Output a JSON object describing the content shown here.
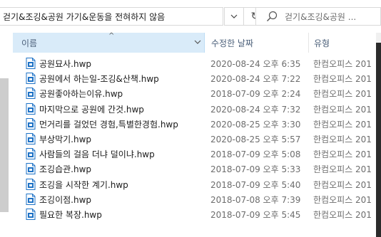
{
  "address": {
    "path": "걷기&조깅&공원 가기&운동을 전혀하지 않음"
  },
  "search": {
    "placeholder": "걷기&조깅&공원 ..."
  },
  "columns": {
    "name": "이름",
    "date": "수정한 날짜",
    "type": "유형"
  },
  "files": [
    {
      "name": "공원묘사.hwp",
      "date": "2020-08-24 오후 6:35",
      "type": "한컴오피스 201"
    },
    {
      "name": "공원에서 하는일-조깅&산책.hwp",
      "date": "2020-08-24 오후 7:22",
      "type": "한컴오피스 201"
    },
    {
      "name": "공원좋아하는이유.hwp",
      "date": "2018-07-09 오후 2:24",
      "type": "한컴오피스 201"
    },
    {
      "name": "마지막으로 공원에 간것.hwp",
      "date": "2020-08-24 오후 7:32",
      "type": "한컴오피스 201"
    },
    {
      "name": "먼거리를 걸었던 경험,특별한경험.hwp",
      "date": "2020-08-25 오후 3:30",
      "type": "한컴오피스 201"
    },
    {
      "name": "부상막기.hwp",
      "date": "2020-08-25 오후 5:57",
      "type": "한컴오피스 201"
    },
    {
      "name": "사람들의 걸음 더냐 덜이냐.hwp",
      "date": "2018-07-09 오후 5:08",
      "type": "한컴오피스 201"
    },
    {
      "name": "조깅습관.hwp",
      "date": "2018-07-09 오후 5:33",
      "type": "한컴오피스 201"
    },
    {
      "name": "조깅을 시작한 계기.hwp",
      "date": "2018-07-09 오후 5:40",
      "type": "한컴오피스 201"
    },
    {
      "name": "조깅이점.hwp",
      "date": "2018-07-08 오후 7:39",
      "type": "한컴오피스 201"
    },
    {
      "name": "필요한 복장.hwp",
      "date": "2018-07-09 오후 5:45",
      "type": "한컴오피스 201"
    }
  ],
  "icons": {
    "refresh": "↻",
    "sort_up": "^",
    "file_icon": "hwp-file-icon"
  },
  "colors": {
    "header_selected_bg": "#d9ebf9",
    "header_text": "#4c607a",
    "file_icon_blue": "#1e72c6"
  }
}
